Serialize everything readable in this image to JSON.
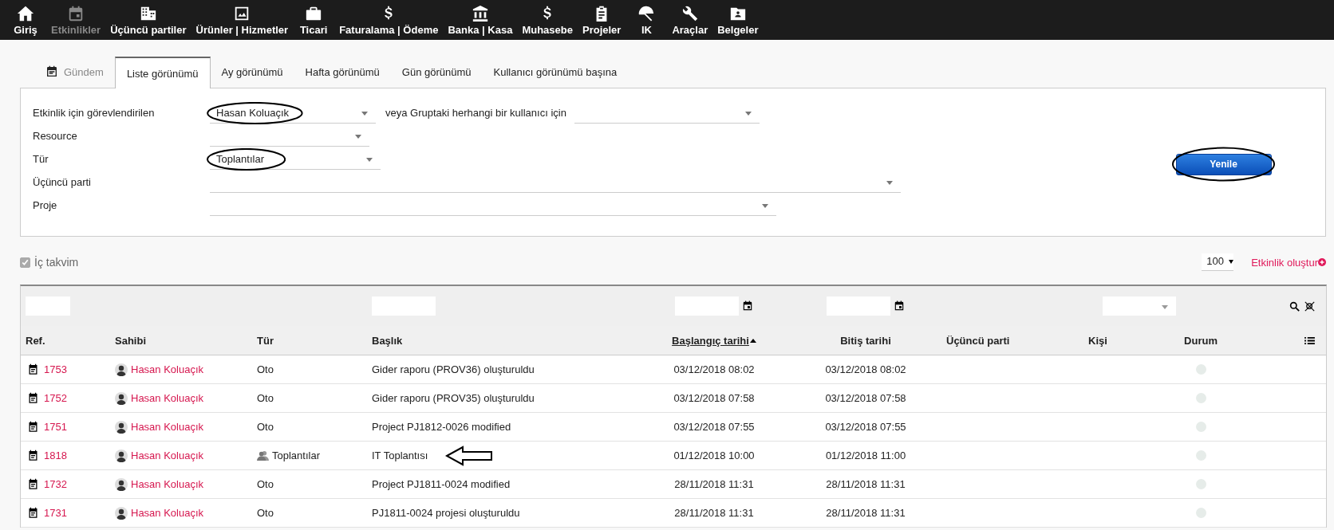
{
  "top_menu": [
    {
      "label": "Giriş",
      "selected": false
    },
    {
      "label": "Etkinlikler",
      "selected": true
    },
    {
      "label": "Üçüncü partiler",
      "selected": false
    },
    {
      "label": "Ürünler | Hizmetler",
      "selected": false
    },
    {
      "label": "Ticari",
      "selected": false
    },
    {
      "label": "Faturalama | Ödeme",
      "selected": false
    },
    {
      "label": "Banka | Kasa",
      "selected": false
    },
    {
      "label": "Muhasebe",
      "selected": false
    },
    {
      "label": "Projeler",
      "selected": false
    },
    {
      "label": "IK",
      "selected": false
    },
    {
      "label": "Araçlar",
      "selected": false
    },
    {
      "label": "Belgeler",
      "selected": false
    }
  ],
  "tabs": [
    {
      "label": "Gündem",
      "selected": false,
      "kind": "icon"
    },
    {
      "label": "Liste görünümü",
      "selected": true,
      "kind": "plain"
    },
    {
      "label": "Ay görünümü",
      "selected": false,
      "kind": "plain"
    },
    {
      "label": "Hafta görünümü",
      "selected": false,
      "kind": "plain"
    },
    {
      "label": "Gün görünümü",
      "selected": false,
      "kind": "plain"
    },
    {
      "label": "Kullanıcı görünümü başına",
      "selected": false,
      "kind": "plain"
    }
  ],
  "filters": [
    {
      "label": "Etkinlik için görevlendirilen",
      "value": "Hasan Koluaçık",
      "circled": true,
      "extra_label": "veya Gruptaki herhangi bir kullanıcı için"
    },
    {
      "label": "Resource",
      "circled": false
    },
    {
      "label": "Tür",
      "value": "Toplantılar",
      "circled": true
    },
    {
      "label": "Üçüncü parti",
      "circled": false
    },
    {
      "label": "Proje",
      "circled": false
    }
  ],
  "refresh_button": {
    "label": "Yenile",
    "circled": true
  },
  "internal_calendar": {
    "label": "İç takvim",
    "checked": true,
    "disabled": true
  },
  "page_size": "100",
  "create_link": "Etkinlik oluştur",
  "table": {
    "columns": [
      {
        "label": "Ref.",
        "sorted": false
      },
      {
        "label": "Sahibi",
        "sorted": false
      },
      {
        "label": "Tür",
        "sorted": false
      },
      {
        "label": "Başlık",
        "sorted": false
      },
      {
        "label": "Başlangıç tarihi",
        "sorted": true
      },
      {
        "label": "Bitiş tarihi",
        "sorted": false
      },
      {
        "label": "Üçüncü parti",
        "sorted": false
      },
      {
        "label": "Kişi",
        "sorted": false
      },
      {
        "label": "Durum",
        "sorted": false
      }
    ],
    "rows": [
      {
        "ref": "1753",
        "owner": "Hasan Koluaçık",
        "type": "Oto",
        "type_icon": false,
        "title": "Gider raporu (PROV36) oluşturuldu",
        "start": "03/12/2018 08:02",
        "end": "03/12/2018 08:02",
        "arrow": false
      },
      {
        "ref": "1752",
        "owner": "Hasan Koluaçık",
        "type": "Oto",
        "type_icon": false,
        "title": "Gider raporu (PROV35) oluşturuldu",
        "start": "03/12/2018 07:58",
        "end": "03/12/2018 07:58",
        "arrow": false
      },
      {
        "ref": "1751",
        "owner": "Hasan Koluaçık",
        "type": "Oto",
        "type_icon": false,
        "title": "Project PJ1812-0026 modified",
        "start": "03/12/2018 07:55",
        "end": "03/12/2018 07:55",
        "arrow": false
      },
      {
        "ref": "1818",
        "owner": "Hasan Koluaçık",
        "type": "Toplantılar",
        "type_icon": true,
        "title": "IT Toplantısı",
        "start": "01/12/2018 10:00",
        "end": "01/12/2018 11:00",
        "arrow": true
      },
      {
        "ref": "1732",
        "owner": "Hasan Koluaçık",
        "type": "Oto",
        "type_icon": false,
        "title": "Project PJ1811-0024 modified",
        "start": "28/11/2018 11:31",
        "end": "28/11/2018 11:31",
        "arrow": false
      },
      {
        "ref": "1731",
        "owner": "Hasan Koluaçık",
        "type": "Oto",
        "type_icon": false,
        "title": "PJ1811-0024 projesi oluşturuldu",
        "start": "28/11/2018 11:31",
        "end": "28/11/2018 11:31",
        "arrow": false
      }
    ]
  }
}
